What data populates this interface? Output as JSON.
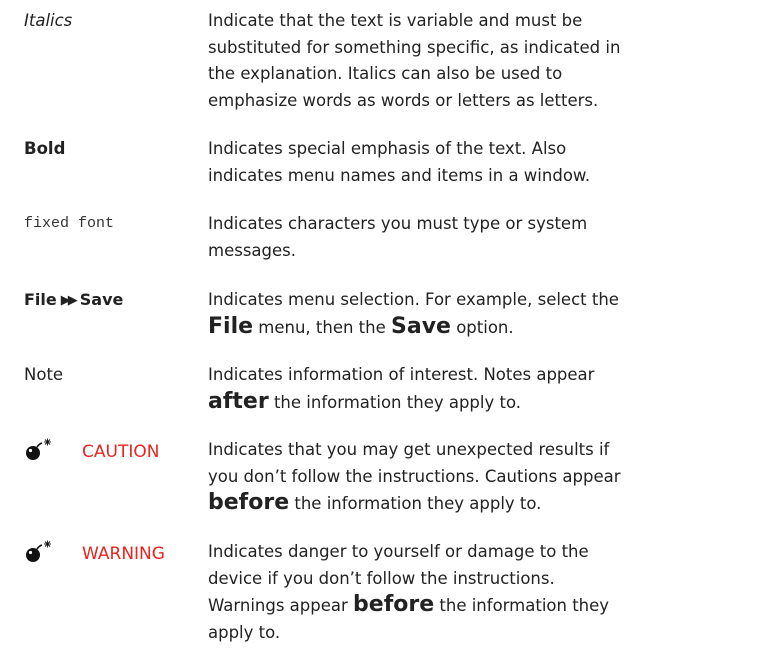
{
  "conventions": [
    {
      "term": "Italics",
      "lines": [
        "Indicate that the text is variable and must be",
        "substituted for something specific, as indicated in",
        "the explanation. Italics can also be used to",
        "emphasize words as words or letters as letters."
      ]
    },
    {
      "term": "Bold",
      "lines": [
        "Indicates special emphasis of the text. Also",
        "indicates menu names and items in a window."
      ]
    },
    {
      "term": "fixed font",
      "lines": [
        "Indicates characters you must type or system",
        "messages."
      ]
    },
    {
      "term_parts": [
        "File",
        "Save"
      ],
      "separator_glyph": "▶▶",
      "line1": "Indicates menu selection. For example, select the",
      "line2": {
        "file": "File",
        "middle": " menu, then the ",
        "save": "Save",
        "end": " option."
      }
    },
    {
      "term": "Note",
      "line1": "Indicates information of interest. Notes appear",
      "line2": {
        "emph": "after",
        "rest": " the information they apply to."
      }
    },
    {
      "icon": "bomb-icon",
      "term": "CAUTION",
      "line1": "Indicates that you may get unexpected results if",
      "line2": "you don’t follow the instructions. Cautions appear",
      "line3": {
        "emph": "before",
        "rest": " the information they apply to."
      }
    },
    {
      "icon": "bomb-icon",
      "term": "WARNING",
      "line1": "Indicates danger to yourself or damage to the",
      "line2": "device if you don’t follow the instructions.",
      "line3": {
        "pre": "Warnings appear ",
        "emph": "before",
        "rest": " the information they"
      },
      "line4": "apply to."
    }
  ],
  "colors": {
    "alert": "#e8251f",
    "text": "#222222"
  }
}
